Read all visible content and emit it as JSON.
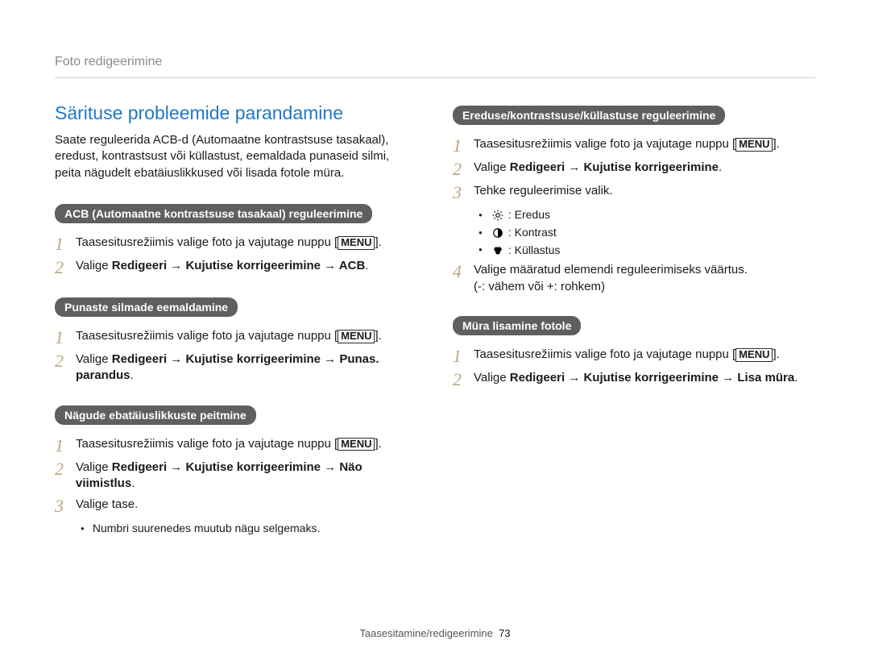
{
  "breadcrumb": "Foto redigeerimine",
  "title": "Särituse probleemide parandamine",
  "intro": "Saate reguleerida ACB-d (Automaatne kontrastsuse tasakaal), eredust, kontrastsust või küllastust, eemaldada punaseid silmi, peita nägudelt ebatäiuslikkused või lisada fotole müra.",
  "menu_label": "MENU",
  "arrow": "→",
  "acb": {
    "label": "ACB (Automaatne kontrastsuse tasakaal) reguleerimine",
    "step1_pre": "Taasesitusrežiimis valige foto ja vajutage nuppu [",
    "step1_post": "].",
    "step2_pre": "Valige ",
    "step2_strong": "Redigeeri → Kujutise korrigeerimine → ACB",
    "step2_post": "."
  },
  "redeye": {
    "label": "Punaste silmade eemaldamine",
    "step1_pre": "Taasesitusrežiimis valige foto ja vajutage nuppu [",
    "step1_post": "].",
    "step2_pre": "Valige ",
    "step2_strong": "Redigeeri → Kujutise korrigeerimine → Punas. parandus",
    "step2_post": "."
  },
  "faces": {
    "label": "Nägude ebatäiuslikkuste peitmine",
    "step1_pre": "Taasesitusrežiimis valige foto ja vajutage nuppu [",
    "step1_post": "].",
    "step2_pre": "Valige ",
    "step2_strong": "Redigeeri → Kujutise korrigeerimine → Näo viimistlus",
    "step2_post": ".",
    "step3": "Valige tase.",
    "step3_bullet": "Numbri suurenedes muutub nägu selgemaks."
  },
  "bcs": {
    "label": "Ereduse/kontrastsuse/küllastuse reguleerimine",
    "step1_pre": "Taasesitusrežiimis valige foto ja vajutage nuppu [",
    "step1_post": "].",
    "step2_pre": "Valige ",
    "step2_strong": "Redigeeri → Kujutise korrigeerimine",
    "step2_post": ".",
    "step3": "Tehke reguleerimise valik.",
    "opt_brightness": ": Eredus",
    "opt_contrast": ": Kontrast",
    "opt_saturation": ": Küllastus",
    "step4a": "Valige määratud elemendi reguleerimiseks väärtus.",
    "step4b": "(-: vähem või +: rohkem)"
  },
  "noise": {
    "label": "Müra lisamine fotole",
    "step1_pre": "Taasesitusrežiimis valige foto ja vajutage nuppu [",
    "step1_post": "].",
    "step2_pre": "Valige ",
    "step2_strong": "Redigeeri → Kujutise korrigeerimine → Lisa müra",
    "step2_post": "."
  },
  "footer_text": "Taasesitamine/redigeerimine",
  "footer_page": "73"
}
